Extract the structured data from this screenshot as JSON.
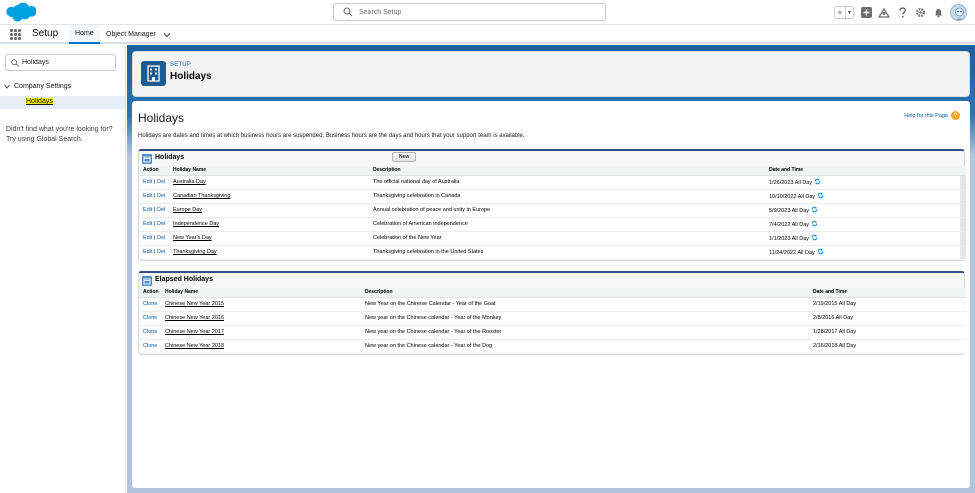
{
  "header": {
    "search_placeholder": "Search Setup",
    "icons": [
      "salesforce-cloud-logo",
      "search-icon",
      "star-icon",
      "chevron-down-icon",
      "add-icon",
      "trailhead-icon",
      "help-icon",
      "gear-icon",
      "bell-icon",
      "avatar"
    ],
    "star_glyph": "★",
    "caret_glyph": "▼"
  },
  "context_bar": {
    "app_name": "Setup",
    "tabs": [
      {
        "label": "Home",
        "active": true
      },
      {
        "label": "Object Manager",
        "active": false
      }
    ]
  },
  "sidebar": {
    "quick_find_value": "Holidays",
    "tree_parent": "Company Settings",
    "tree_child": "Holidays",
    "no_result_line1": "Didn't find what you're looking for?",
    "no_result_line2": "Try using Global Search."
  },
  "page_header": {
    "subtitle": "SETUP",
    "title": "Holidays"
  },
  "content": {
    "title": "Holidays",
    "help_link": "Help for this Page",
    "help_glyph": "?",
    "description": "Holidays are dates and times at which business hours are suspended. Business hours are the days and hours that your support team is available."
  },
  "holidays_list": {
    "title": "Holidays",
    "new_button": "New",
    "columns": [
      "Action",
      "Holiday Name",
      "Description",
      "Date and Time"
    ],
    "edit_label": "Edit",
    "separator": "|",
    "del_label": "Del",
    "rows": [
      {
        "name": "Australia Day",
        "description": "The official national day of Australia",
        "date": "1/26/2023 All Day"
      },
      {
        "name": "Canadian Thanksgiving",
        "description": "Thanksgiving celebration in Canada",
        "date": "10/10/2022 All Day"
      },
      {
        "name": "Europe Day",
        "description": "Annual celebration of peace and unity in Europe",
        "date": "5/9/2023 All Day"
      },
      {
        "name": "Independence Day",
        "description": "Celebration of American independence",
        "date": "7/4/2022 All Day"
      },
      {
        "name": "New Year's Day",
        "description": "Celebration of the New Year",
        "date": "1/1/2023 All Day"
      },
      {
        "name": "Thanksgiving Day",
        "description": "Thanksgiving celebration in the United States",
        "date": "11/24/2022 All Day"
      }
    ]
  },
  "elapsed_list": {
    "title": "Elapsed Holidays",
    "columns": [
      "Action",
      "Holiday Name",
      "Description",
      "Date and Time"
    ],
    "clone_label": "Clone",
    "rows": [
      {
        "name": "Chinese New Year 2015",
        "description": "New Year on the Chinese Calendar - Year of the Goat",
        "date": "2/19/2015 All Day"
      },
      {
        "name": "Chinese New Year 2016",
        "description": "New year on the Chinese calendar - Year of the Monkey",
        "date": "2/8/2016 All Day"
      },
      {
        "name": "Chinese New Year 2017",
        "description": "New year on the Chinese calendar - Year of the Rooster",
        "date": "1/28/2017 All Day"
      },
      {
        "name": "Chinese New Year 2018",
        "description": "New year on the Chinese calendar - Year of the Dog",
        "date": "2/16/2018 All Day"
      }
    ]
  },
  "colors": {
    "brand_blue": "#0176d3",
    "link_blue": "#015ba7",
    "setup_banner": "#1b5f9e",
    "highlight": "#f4f000"
  }
}
